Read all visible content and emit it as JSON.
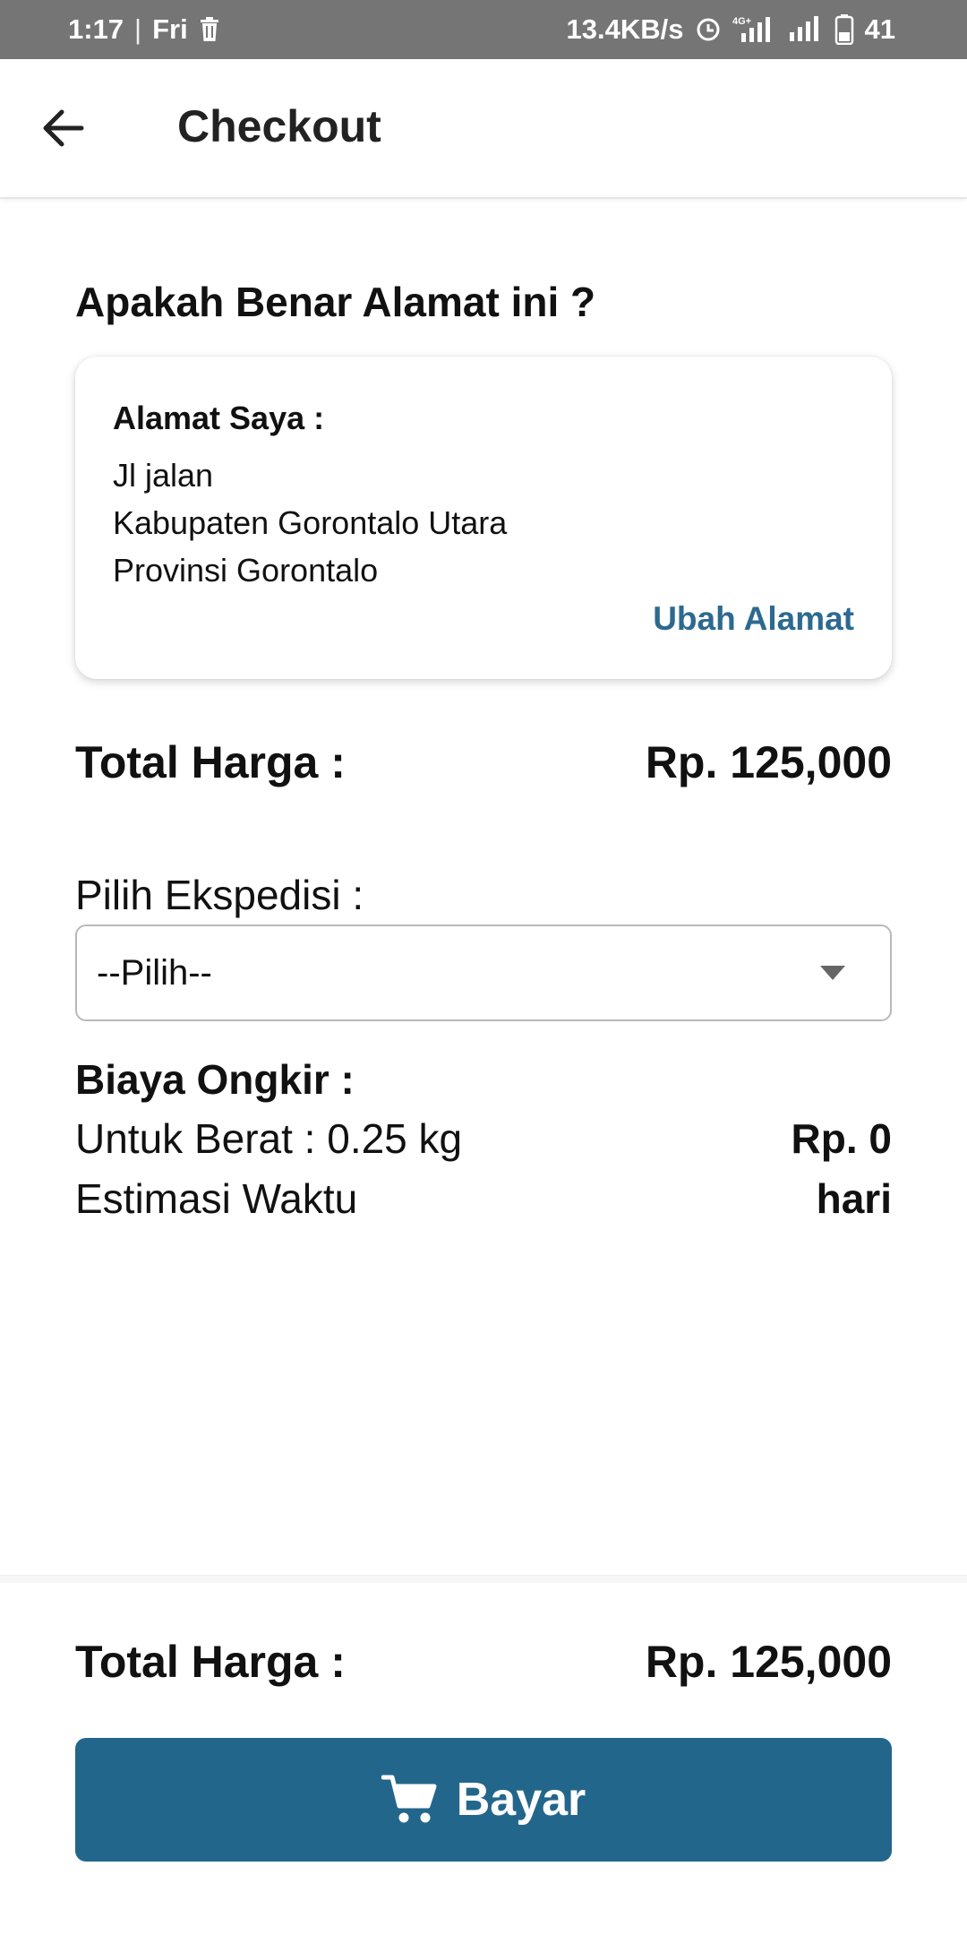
{
  "status_bar": {
    "time": "1:17",
    "separator": "|",
    "day": "Fri",
    "network_speed": "13.4KB/s",
    "network_type": "4G+",
    "battery": "41",
    "icons": [
      "trash-icon",
      "alarm-icon",
      "signal-icon",
      "signal-icon",
      "battery-icon"
    ]
  },
  "header": {
    "title": "Checkout",
    "back_icon": "arrow-left-icon"
  },
  "address": {
    "question": "Apakah Benar Alamat ini ?",
    "label": "Alamat Saya :",
    "lines": [
      "Jl jalan",
      "Kabupaten Gorontalo Utara",
      "Provinsi Gorontalo"
    ],
    "change_link": "Ubah Alamat"
  },
  "summary": {
    "total_label": "Total Harga :",
    "total_value": "Rp. 125,000"
  },
  "expedition": {
    "label": "Pilih Ekspedisi :",
    "selected": "--Pilih--"
  },
  "shipping": {
    "title": "Biaya Ongkir :",
    "weight_label": "Untuk Berat : 0.25 kg",
    "weight_value": "Rp. 0",
    "estimate_label": "Estimasi Waktu",
    "estimate_value": "hari"
  },
  "footer": {
    "total_label": "Total Harga :",
    "total_value": "Rp. 125,000",
    "pay_label": "Bayar",
    "pay_icon": "cart-icon"
  },
  "colors": {
    "status_bar": "#757575",
    "accent": "#23668b",
    "link": "#2c6a8f"
  }
}
